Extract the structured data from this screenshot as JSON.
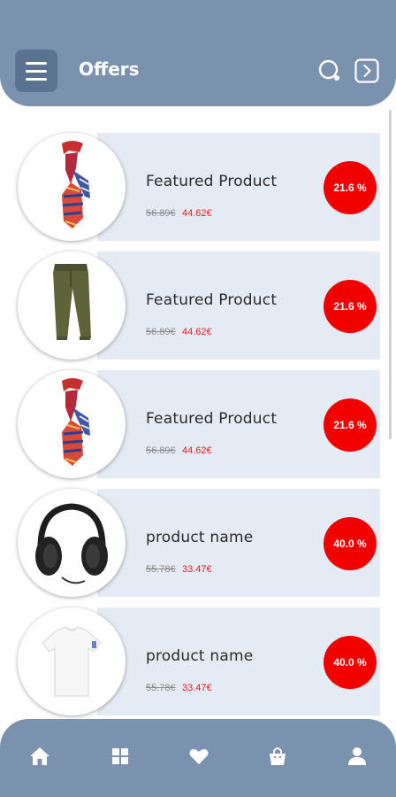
{
  "header": {
    "title": "Offers",
    "icons": [
      "menu-icon",
      "search-icon",
      "chevron-right-icon"
    ]
  },
  "colors": {
    "header_bg": "#7a92ae",
    "card_bg": "#e5ebf4",
    "badge": "#f20000",
    "sale_price": "#e0181b"
  },
  "products": [
    {
      "name": "Featured Product",
      "old_price": "56.89€",
      "new_price": "44.62€",
      "discount": "21.6 %",
      "image": "scarf"
    },
    {
      "name": "Featured Product",
      "old_price": "56.89€",
      "new_price": "44.62€",
      "discount": "21.6 %",
      "image": "pants"
    },
    {
      "name": "Featured Product",
      "old_price": "56.89€",
      "new_price": "44.62€",
      "discount": "21.6 %",
      "image": "scarf"
    },
    {
      "name": "product name",
      "old_price": "55.78€",
      "new_price": "33.47€",
      "discount": "40.0 %",
      "image": "headphones"
    },
    {
      "name": "product name",
      "old_price": "55.78€",
      "new_price": "33.47€",
      "discount": "40.0 %",
      "image": "tshirt"
    }
  ],
  "bottom_nav": [
    "home-icon",
    "grid-icon",
    "heart-icon",
    "bag-icon",
    "user-icon"
  ]
}
